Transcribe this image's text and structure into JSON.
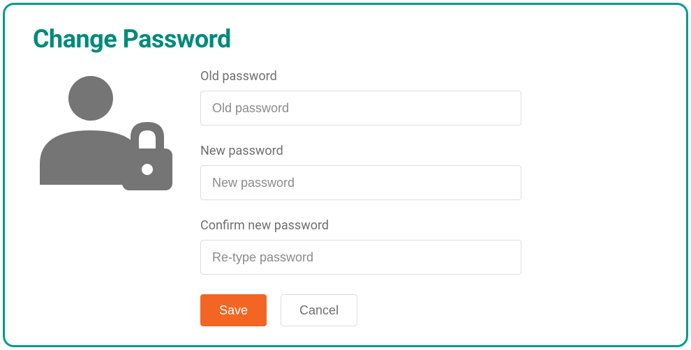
{
  "page_title": "Change Password",
  "fields": {
    "old": {
      "label": "Old password",
      "placeholder": "Old password"
    },
    "new": {
      "label": "New password",
      "placeholder": "New password"
    },
    "confirm": {
      "label": "Confirm new password",
      "placeholder": "Re-type password"
    }
  },
  "buttons": {
    "save": "Save",
    "cancel": "Cancel"
  },
  "colors": {
    "accent": "#008a7c",
    "border": "#009b8e",
    "primary_button": "#f26522",
    "icon_fill": "#757575"
  }
}
